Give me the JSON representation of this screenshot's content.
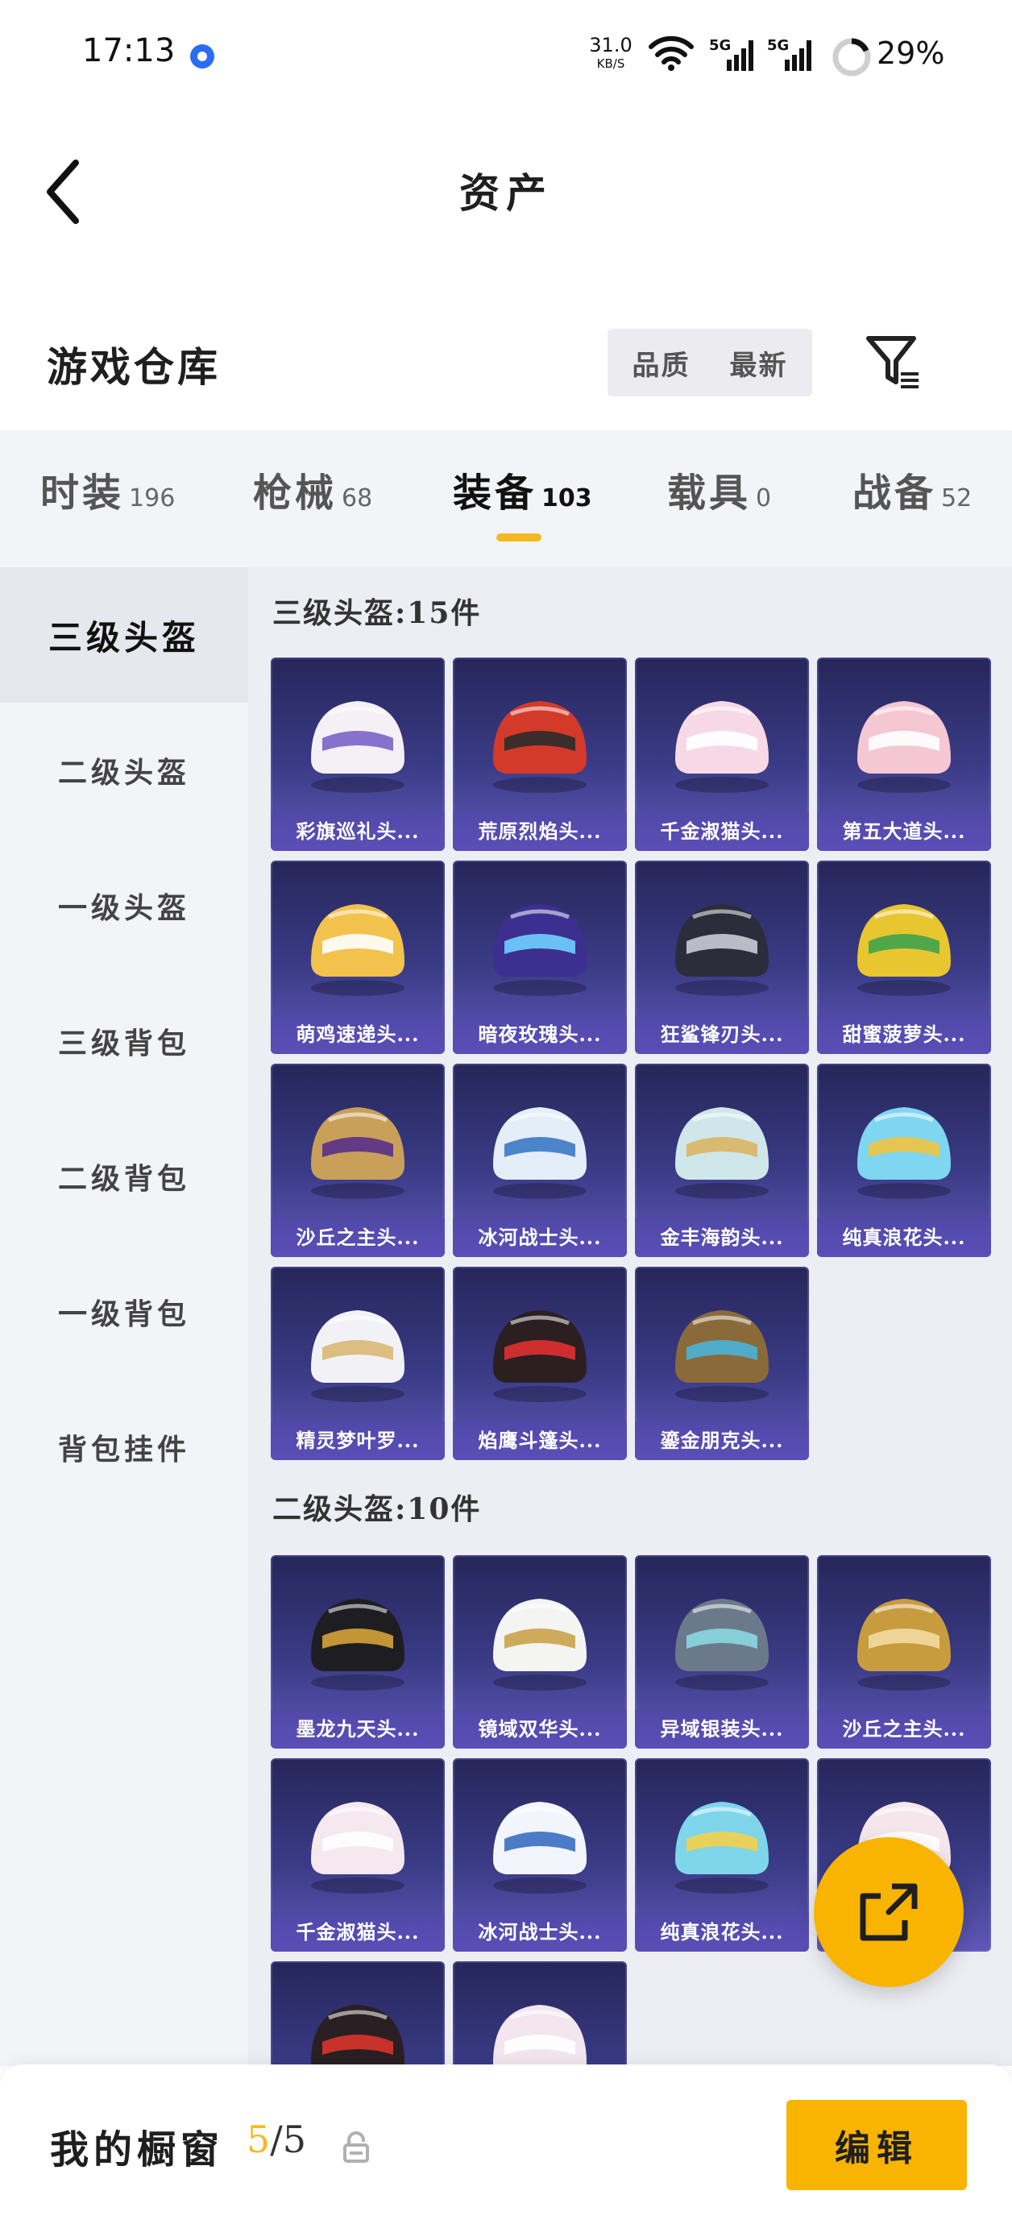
{
  "status_bar": {
    "time": "17:13",
    "speed_value": "31.0",
    "speed_unit": "KB/S",
    "network_1": "5G",
    "network_2": "5G",
    "battery_percent": "29%"
  },
  "header": {
    "title": "资产"
  },
  "warehouse": {
    "title": "游戏仓库",
    "sort_options": [
      "品质",
      "最新"
    ],
    "sort_active_index": 0
  },
  "tabs": [
    {
      "label": "时装",
      "count": "196"
    },
    {
      "label": "枪械",
      "count": "68"
    },
    {
      "label": "装备",
      "count": "103"
    },
    {
      "label": "载具",
      "count": "0"
    },
    {
      "label": "战备",
      "count": "52"
    }
  ],
  "active_tab_index": 2,
  "sidebar": {
    "items": [
      "三级头盔",
      "二级头盔",
      "一级头盔",
      "三级背包",
      "二级背包",
      "一级背包",
      "背包挂件"
    ],
    "active_index": 0
  },
  "sections": [
    {
      "title": "三级头盔:15件",
      "items": [
        "彩旗巡礼头...",
        "荒原烈焰头...",
        "千金淑猫头...",
        "第五大道头...",
        "萌鸡速递头...",
        "暗夜玫瑰头...",
        "狂鲨锋刃头...",
        "甜蜜菠萝头...",
        "沙丘之主头...",
        "冰河战士头...",
        "金丰海韵头...",
        "纯真浪花头...",
        "精灵梦叶罗...",
        "焰鹰斗篷头...",
        "鎏金朋克头..."
      ]
    },
    {
      "title": "二级头盔:10件",
      "items": [
        "墨龙九天头...",
        "镜域双华头...",
        "异域银装头...",
        "沙丘之主头...",
        "千金淑猫头...",
        "冰河战士头...",
        "纯真浪花头...",
        "",
        "",
        ""
      ]
    }
  ],
  "bottom_bar": {
    "label": "我的橱窗",
    "current": "5",
    "separator": "/",
    "total": "5",
    "edit_label": "编辑"
  },
  "colors": {
    "accent": "#f8b400",
    "card_top": "#26265a",
    "card_bottom": "#6058b8",
    "panel_bg": "#f3f4f8"
  }
}
